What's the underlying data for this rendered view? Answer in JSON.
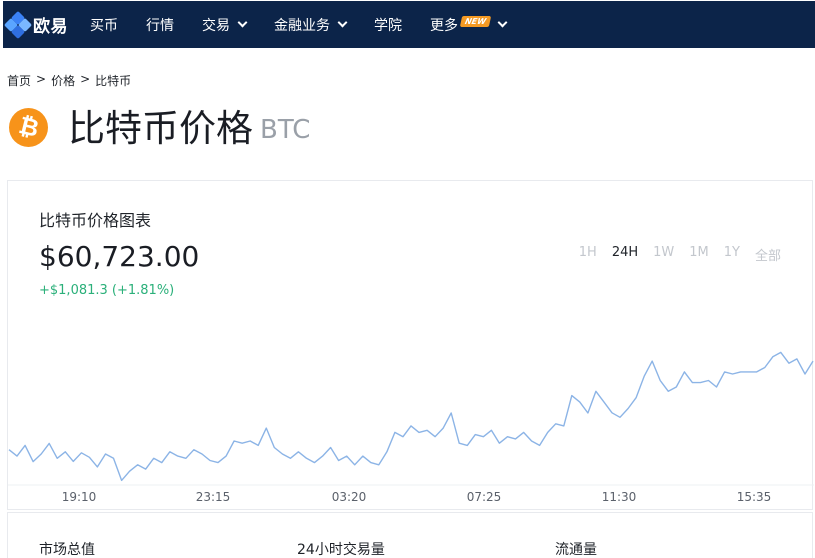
{
  "nav": {
    "logo_text": "欧易",
    "items": [
      {
        "label": "买币",
        "dropdown": false
      },
      {
        "label": "行情",
        "dropdown": false
      },
      {
        "label": "交易",
        "dropdown": true
      },
      {
        "label": "金融业务",
        "dropdown": true
      },
      {
        "label": "学院",
        "dropdown": false
      },
      {
        "label": "更多",
        "dropdown": true,
        "badge": "NEW"
      }
    ],
    "background_color": "#0c2449",
    "badge_color": "#f59a23"
  },
  "breadcrumb": {
    "items": [
      "首页",
      "价格",
      "比特币"
    ],
    "separator": ">"
  },
  "title": {
    "coin_icon": "bitcoin-icon",
    "coin_glyph": "₿",
    "coin_color": "#f7931a",
    "name": "比特币价格",
    "symbol": "BTC"
  },
  "chart_card": {
    "title": "比特币价格图表",
    "price": "$60,723.00",
    "change": "+$1,081.3 (+1.81%)",
    "change_color": "#2bb07a",
    "line_color": "#8cb4e6",
    "ranges": [
      {
        "label": "1H",
        "active": false
      },
      {
        "label": "24H",
        "active": true
      },
      {
        "label": "1W",
        "active": false
      },
      {
        "label": "1M",
        "active": false
      },
      {
        "label": "1Y",
        "active": false
      },
      {
        "label": "全部",
        "active": false
      }
    ]
  },
  "chart_data": {
    "type": "line",
    "title": "",
    "xlabel": "",
    "ylabel": "",
    "x_ticks": [
      "19:10",
      "23:15",
      "03:20",
      "07:25",
      "11:30",
      "15:35"
    ],
    "grid": false,
    "series": [
      {
        "values": [
          59645,
          59606,
          59671,
          59573,
          59619,
          59683,
          59593,
          59632,
          59574,
          59626,
          59599,
          59541,
          59619,
          59593,
          59460,
          59515,
          59554,
          59528,
          59593,
          59567,
          59632,
          59606,
          59593,
          59645,
          59619,
          59580,
          59567,
          59606,
          59697,
          59684,
          59697,
          59671,
          59775,
          59658,
          59619,
          59593,
          59632,
          59593,
          59567,
          59606,
          59658,
          59580,
          59606,
          59554,
          59606,
          59567,
          59554,
          59632,
          59749,
          59723,
          59788,
          59749,
          59762,
          59723,
          59775,
          59866,
          59684,
          59671,
          59736,
          59723,
          59762,
          59684,
          59723,
          59710,
          59749,
          59697,
          59671,
          59749,
          59801,
          59788,
          59971,
          59932,
          59866,
          59997,
          59932,
          59867,
          59840,
          59893,
          59958,
          60088,
          60179,
          60062,
          59997,
          60023,
          60114,
          60049,
          60049,
          60062,
          60023,
          60114,
          60101,
          60114,
          60114,
          60114,
          60140,
          60205,
          60231,
          60166,
          60192,
          60101,
          60179
        ]
      }
    ]
  },
  "stats": {
    "labels": [
      "市场总值",
      "24小时交易量",
      "流通量"
    ]
  }
}
